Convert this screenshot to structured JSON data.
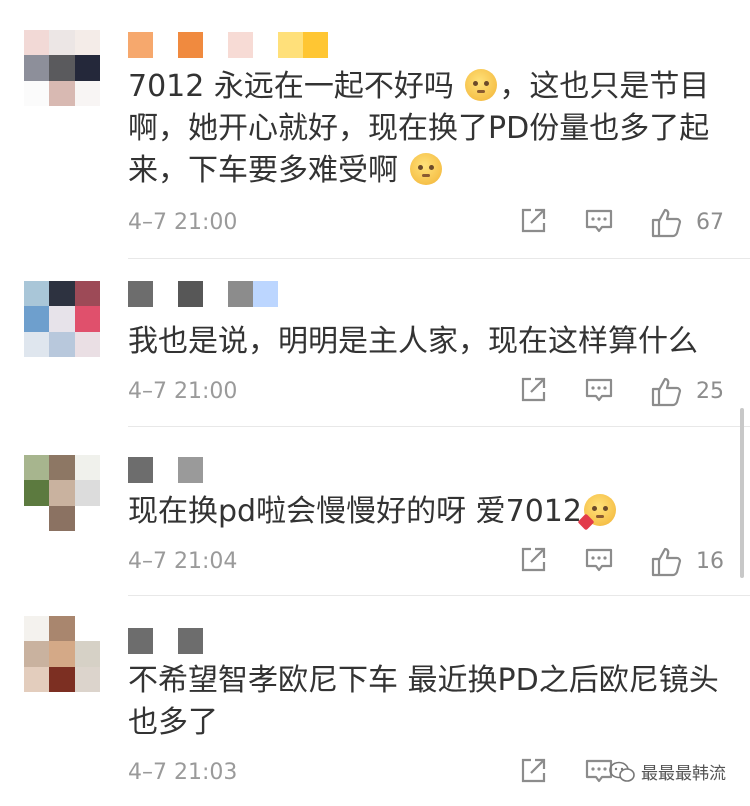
{
  "colors": {
    "text": "#333333",
    "meta": "#9a9a9a",
    "divider": "#e8e8e8"
  },
  "comments": [
    {
      "text_parts": [
        "7012 永远在一起不好吗 ",
        "，这也只是节目啊，她开心就好，现在换了PD份量也多了起来，下车要多难受啊 "
      ],
      "time": "4–7 21:00",
      "likes": "67",
      "avatar_colors": [
        "#f2d9d6",
        "#ece6e5",
        "#f4ece8",
        "#8d8f9a",
        "#5a5a5d",
        "#24283a",
        "#fbfbfb",
        "#d8b9b2",
        "#f8f5f4"
      ],
      "name_colors": [
        "#f6a86d",
        "#ffffff",
        "#f08a3f",
        "#ffffff",
        "#f7dbd5",
        "#ffffff",
        "#ffe07a",
        "#ffc633"
      ]
    },
    {
      "text_parts": [
        "我也是说，明明是主人家，现在这样算什么"
      ],
      "time": "4–7 21:00",
      "likes": "25",
      "avatar_colors": [
        "#a9c6d8",
        "#2d3240",
        "#9d4a57",
        "#6e9fcd",
        "#e7e3ea",
        "#e0506c",
        "#dfe6ee",
        "#b8c8dc",
        "#eadfe4"
      ],
      "name_colors": [
        "#6d6d6d",
        "#ffffff",
        "#575757",
        "#ffffff",
        "#8c8c8c",
        "#bcd6ff"
      ]
    },
    {
      "text_parts": [
        "现在换pd啦会慢慢好的呀 爱7012"
      ],
      "time": "4–7 21:04",
      "likes": "16",
      "avatar_colors": [
        "#a7b58e",
        "#8d7764",
        "#f0f1ec",
        "#5c7a3f",
        "#c9b29f",
        "#dcdcdc",
        "#ffffff",
        "#8b7262",
        "#ffffff"
      ],
      "name_colors": [
        "#6d6d6d",
        "#ffffff",
        "#9a9a9a"
      ]
    },
    {
      "text_parts": [
        "不希望智孝欧尼下车  最近换PD之后欧尼镜头也多了"
      ],
      "time": "4–7 21:03",
      "likes": "",
      "avatar_colors": [
        "#f4f2ee",
        "#a9866e",
        "#ffffff",
        "#c9b29f",
        "#d4a987",
        "#d6d1c6",
        "#e3cdbd",
        "#7c2f22",
        "#dcd4cc"
      ],
      "name_colors": [
        "#6d6d6d",
        "#ffffff",
        "#6d6d6d"
      ]
    }
  ],
  "watermark": {
    "label": "最最最韩流",
    "icon": "wechat-official-account-icon"
  }
}
